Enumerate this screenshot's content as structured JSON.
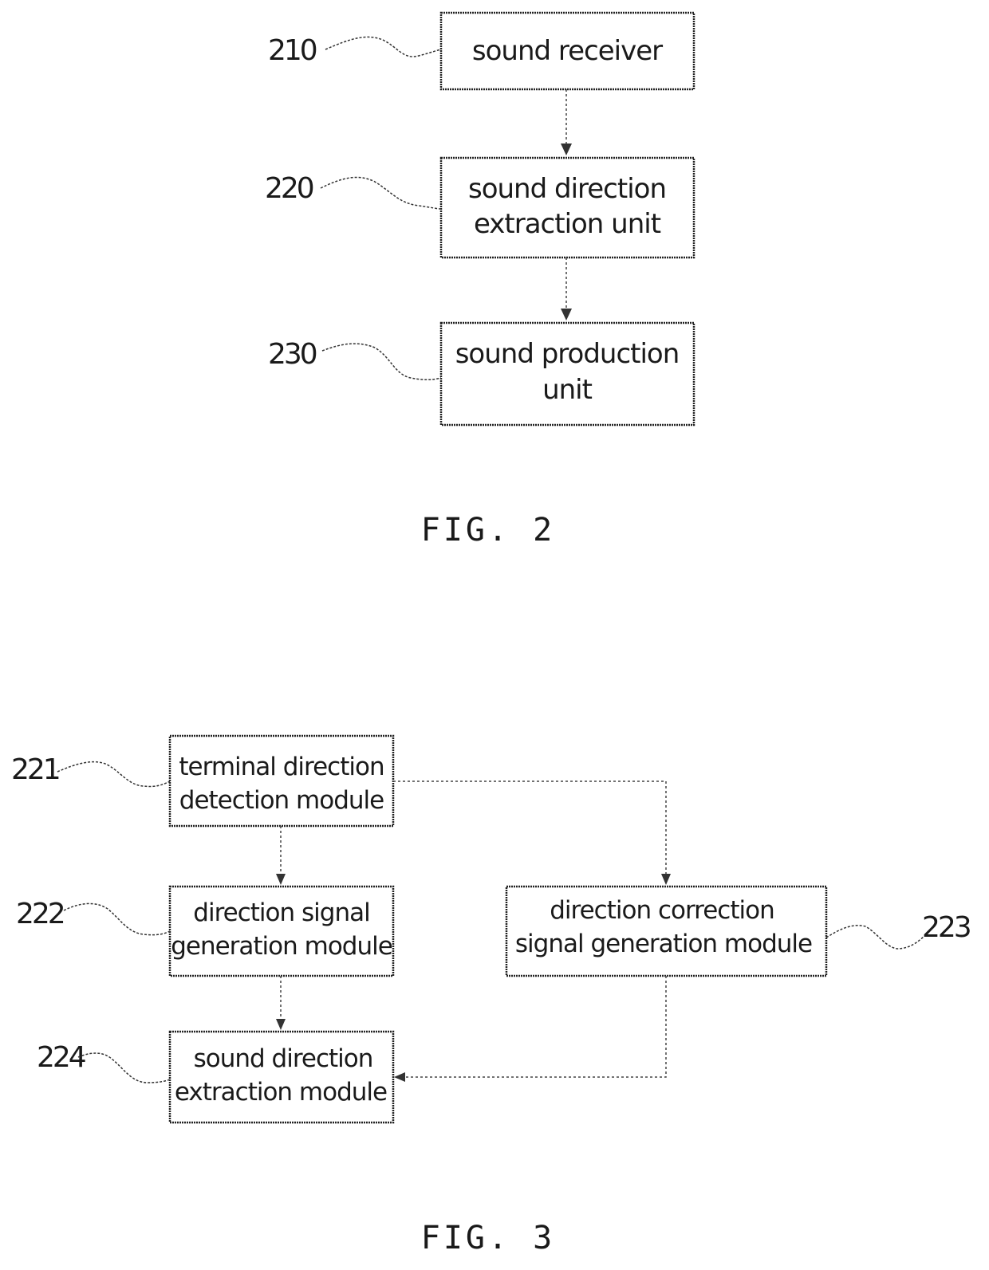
{
  "figures": [
    {
      "caption": "FIG. 2",
      "blocks": [
        {
          "ref": "210",
          "lines": [
            "sound receiver"
          ]
        },
        {
          "ref": "220",
          "lines": [
            "sound direction",
            "extraction unit"
          ]
        },
        {
          "ref": "230",
          "lines": [
            "sound production",
            "unit"
          ]
        }
      ],
      "connections": [
        {
          "from": "210",
          "to": "220"
        },
        {
          "from": "220",
          "to": "230"
        }
      ]
    },
    {
      "caption": "FIG. 3",
      "blocks": [
        {
          "ref": "221",
          "lines": [
            "terminal direction",
            "detection module"
          ]
        },
        {
          "ref": "222",
          "lines": [
            "direction signal",
            "generation module"
          ]
        },
        {
          "ref": "223",
          "lines": [
            "direction correction",
            "signal generation module"
          ]
        },
        {
          "ref": "224",
          "lines": [
            "sound direction",
            "extraction module"
          ]
        }
      ],
      "connections": [
        {
          "from": "221",
          "to": "222"
        },
        {
          "from": "221",
          "to": "223"
        },
        {
          "from": "222",
          "to": "224"
        },
        {
          "from": "223",
          "to": "224"
        }
      ]
    }
  ]
}
